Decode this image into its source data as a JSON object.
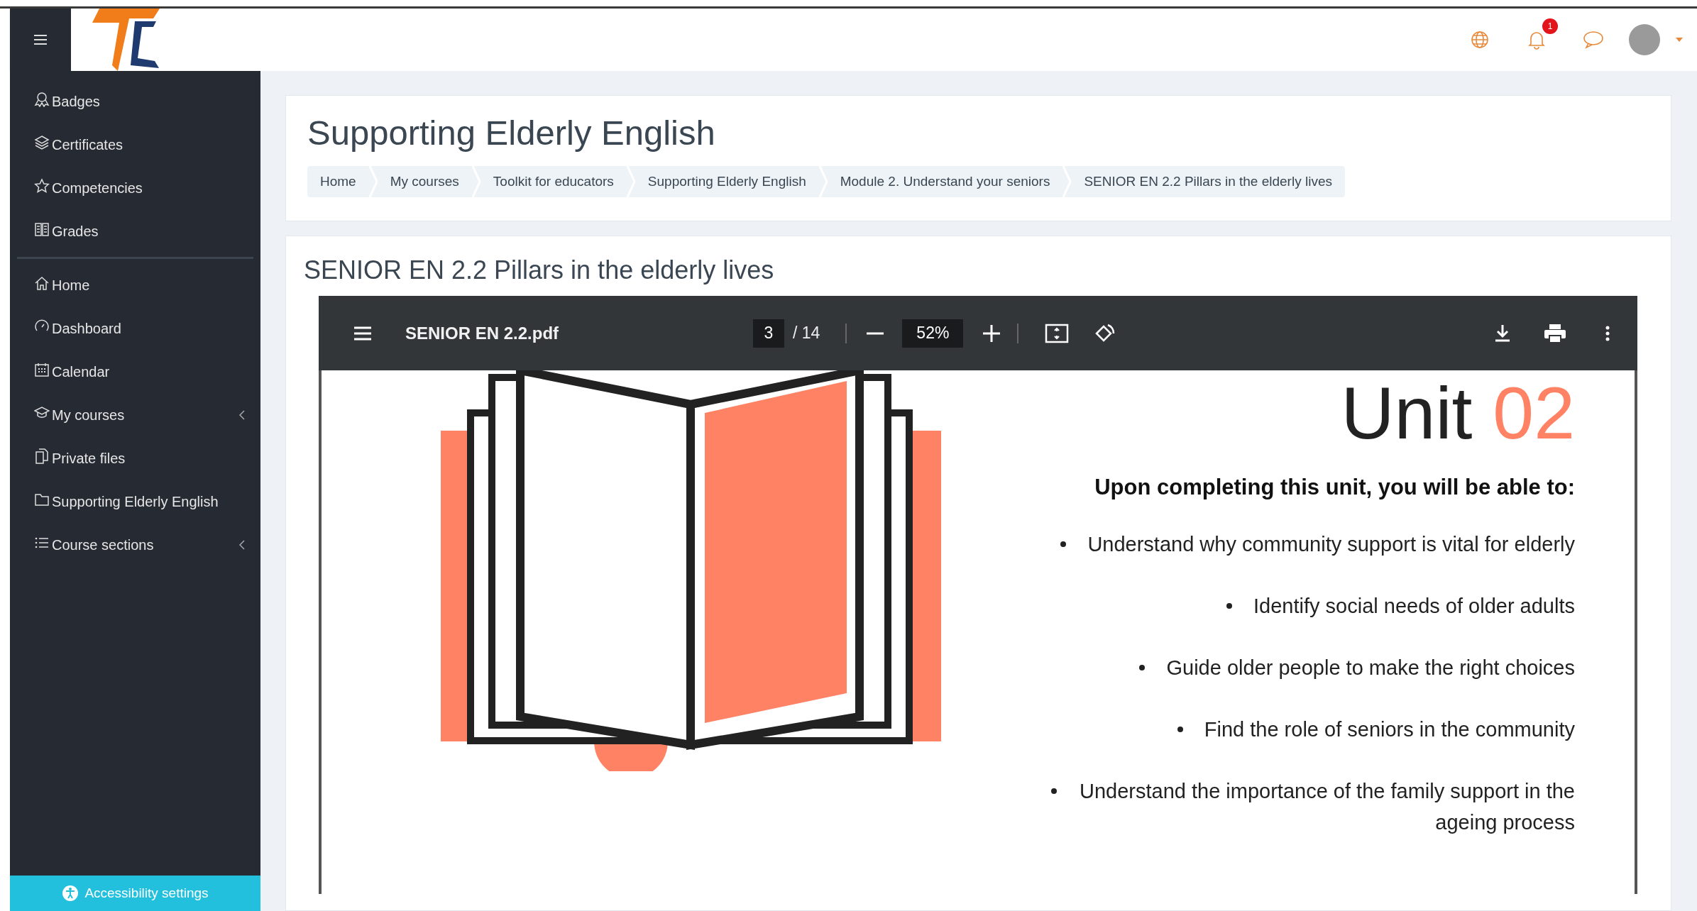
{
  "top_bar": {
    "notification_count": "1"
  },
  "sidebar": {
    "groups": [
      {
        "items": [
          {
            "label": "Badges",
            "kind": "link"
          },
          {
            "label": "Certificates",
            "kind": "link"
          },
          {
            "label": "Competencies",
            "kind": "link"
          },
          {
            "label": "Grades",
            "kind": "link"
          }
        ]
      },
      {
        "items": [
          {
            "label": "Home",
            "kind": "link"
          },
          {
            "label": "Dashboard",
            "kind": "link"
          },
          {
            "label": "Calendar",
            "kind": "link"
          },
          {
            "label": "My courses",
            "kind": "group"
          },
          {
            "label": "Private files",
            "kind": "link"
          },
          {
            "label": "Supporting Elderly English",
            "kind": "link"
          },
          {
            "label": "Course sections",
            "kind": "group"
          }
        ]
      }
    ],
    "footer_button": "Accessibility settings"
  },
  "page_header": {
    "title": "Supporting Elderly English",
    "breadcrumbs": [
      "Home",
      "My courses",
      "Toolkit for educators",
      "Supporting Elderly English",
      "Module 2. Understand your seniors",
      "SENIOR EN 2.2 Pillars in the elderly lives"
    ]
  },
  "activity": {
    "title": "SENIOR EN 2.2 Pillars in the elderly lives",
    "pdf_viewer": {
      "file_name": "SENIOR EN 2.2.pdf",
      "page": "3",
      "page_count": "/ 14",
      "zoom": "52%",
      "slide": {
        "heading_word": "Unit",
        "heading_number": "02",
        "subtitle": "Upon completing this unit, you will be able to:",
        "bullets": [
          "Understand why community support is vital for elderly",
          "Identify social needs of older adults",
          "Guide older people to make the right choices",
          "Find the role of seniors in the community",
          "Understand the importance of the family support in the ageing process"
        ]
      }
    }
  }
}
